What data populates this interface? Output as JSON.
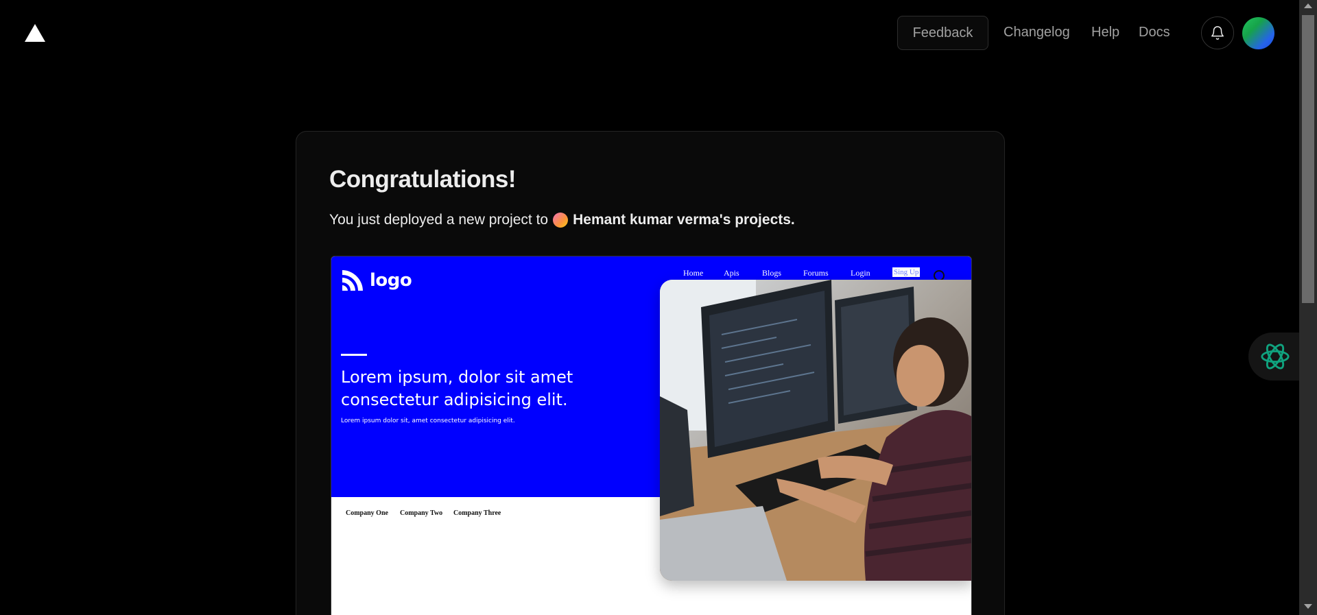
{
  "nav": {
    "feedback": "Feedback",
    "changelog": "Changelog",
    "help": "Help",
    "docs": "Docs"
  },
  "card": {
    "title": "Congratulations!",
    "subtitle_prefix": "You just deployed a new project to",
    "team_name": "Hemant kumar verma's projects."
  },
  "preview": {
    "logo_text": "logo",
    "nav_items": [
      "Home",
      "Apis",
      "Blogs",
      "Forums",
      "Login"
    ],
    "signup": "Sing Up",
    "headline": "Lorem ipsum, dolor sit amet consectetur adipisicing elit.",
    "subtext": "Lorem ipsum dolor sit, amet consectetur adipisicing elit.",
    "companies": [
      "Company One",
      "Company Two",
      "Company Three"
    ]
  },
  "colors": {
    "background": "#000000",
    "card": "#0a0a0a",
    "preview_hero": "#0000ff",
    "ai_icon": "#10a37f"
  },
  "icons": {
    "logo": "triangle-logo-icon",
    "bell": "bell-icon",
    "ai": "openai-icon",
    "preview_logo": "rss-icon",
    "search": "search-icon"
  }
}
